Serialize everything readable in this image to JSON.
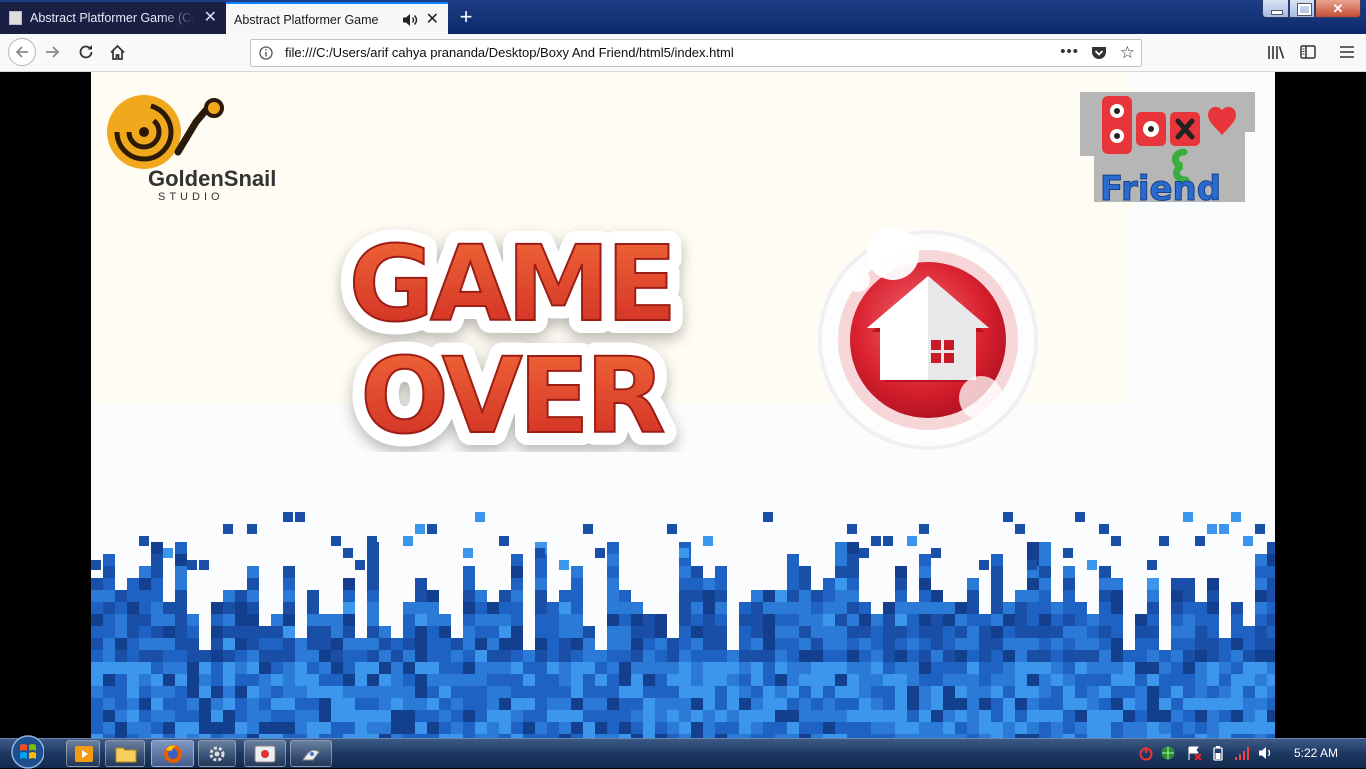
{
  "browser": {
    "tabs": [
      {
        "title": "Abstract Platformer Game (Con",
        "active": false,
        "close_label": "✕"
      },
      {
        "title": "Abstract Platformer Game",
        "active": true,
        "close_label": "✕"
      }
    ],
    "new_tab_label": "+",
    "url": "file:///C:/Users/arif cahya prananda/Desktop/Boxy And Friend/html5/index.html",
    "url_more_label": "•••",
    "star_label": "☆",
    "window_close_label": "✕",
    "accent": "#0a84ff"
  },
  "game": {
    "studio_logo": {
      "name": "GoldenSnail",
      "tagline": "STUDIO",
      "color": "#f0a81c"
    },
    "game_logo": {
      "line1": "BOXY",
      "ampersand": "&",
      "line2": "Friend",
      "title_color": "#e8353b",
      "subtitle_color": "#2a6bd0"
    },
    "game_over": {
      "line1": "GAME",
      "line2": "OVER",
      "fill_color": "#e3402a",
      "outline_color": "#ffffff"
    },
    "home_button": {
      "label": "home",
      "color": "#d9202f"
    },
    "ground_colors": [
      "#1a4fa8",
      "#1e62c4",
      "#2b7ad8",
      "#3c97ec",
      "#12408f"
    ]
  },
  "taskbar": {
    "clock": "5:22 AM",
    "pinned_apps": [
      "media-player",
      "file-explorer",
      "firefox",
      "settings",
      "app-5",
      "app-6"
    ]
  }
}
